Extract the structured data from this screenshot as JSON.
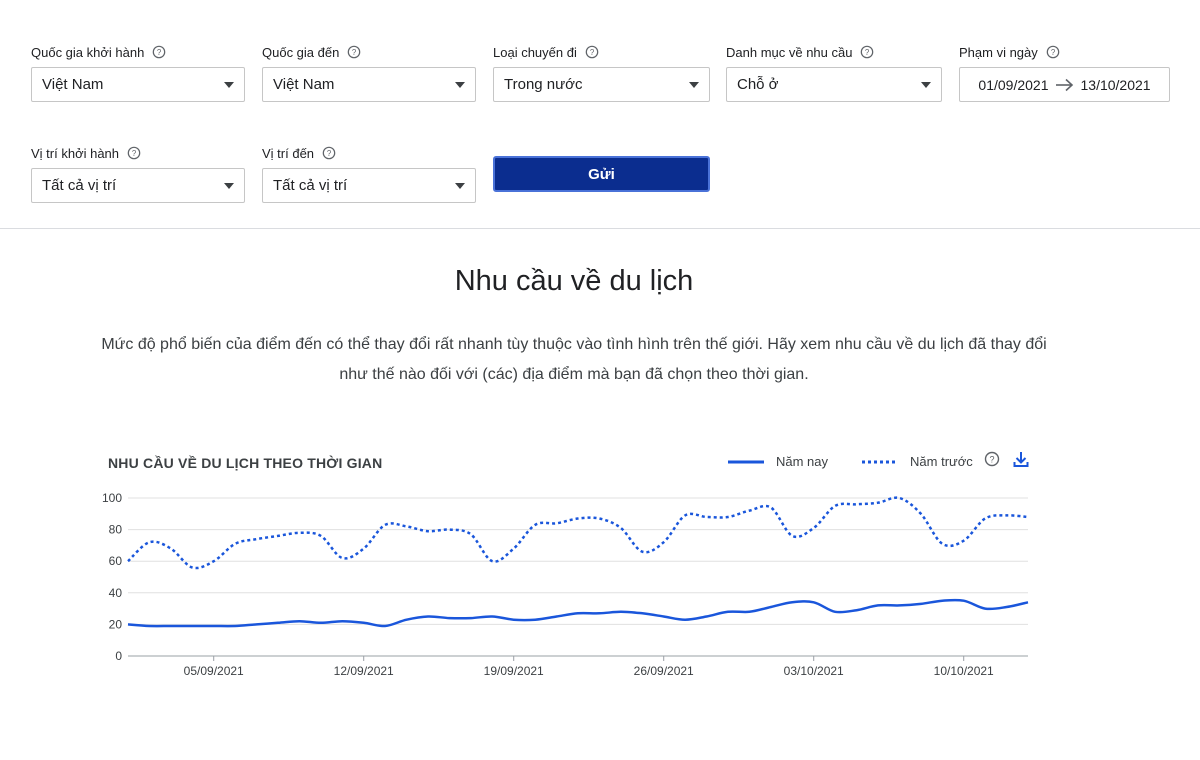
{
  "filters": {
    "origin_country": {
      "label": "Quốc gia khởi hành",
      "value": "Việt Nam"
    },
    "dest_country": {
      "label": "Quốc gia đến",
      "value": "Việt Nam"
    },
    "trip_type": {
      "label": "Loại chuyến đi",
      "value": "Trong nước"
    },
    "demand_category": {
      "label": "Danh mục về nhu cầu",
      "value": "Chỗ ở"
    },
    "date_range": {
      "label": "Phạm vi ngày",
      "start": "01/09/2021",
      "end": "13/10/2021"
    },
    "origin_location": {
      "label": "Vị trí khởi hành",
      "value": "Tất cả vị trí"
    },
    "dest_location": {
      "label": "Vị trí đến",
      "value": "Tất cả vị trí"
    },
    "submit_label": "Gửi"
  },
  "section": {
    "heading": "Nhu cầu về du lịch",
    "description": "Mức độ phổ biến của điểm đến có thể thay đổi rất nhanh tùy thuộc vào tình hình trên thế giới. Hãy xem nhu cầu về du lịch đã thay đổi như thế nào đối với (các) địa điểm mà bạn đã chọn theo thời gian."
  },
  "colors": {
    "series": "#1a56db",
    "submit_bg": "#0b2d8f",
    "grid": "#e0e0e0",
    "axis": "#9aa0a6"
  },
  "icons": {
    "help": "help-circle-icon",
    "download": "download-icon",
    "arrow": "arrow-right-icon",
    "caret": "chevron-down-icon"
  },
  "chart_data": {
    "type": "line",
    "title": "NHU CẦU VỀ DU LỊCH THEO THỜI GIAN",
    "xlabel": "",
    "ylabel": "",
    "ylim": [
      0,
      100
    ],
    "y_ticks": [
      0,
      20,
      40,
      60,
      80,
      100
    ],
    "x_start": "01/09/2021",
    "x_tick_labels": [
      "05/09/2021",
      "12/09/2021",
      "19/09/2021",
      "26/09/2021",
      "03/10/2021",
      "10/10/2021"
    ],
    "x_tick_day_index": [
      4,
      11,
      18,
      25,
      32,
      39
    ],
    "grid": true,
    "legend_position": "top-right",
    "series": [
      {
        "name": "Năm nay",
        "style": "solid",
        "values": [
          20,
          19,
          19,
          19,
          19,
          19,
          20,
          21,
          22,
          21,
          22,
          21,
          19,
          23,
          25,
          24,
          24,
          25,
          23,
          23,
          25,
          27,
          27,
          28,
          27,
          25,
          23,
          25,
          28,
          28,
          31,
          34,
          34,
          28,
          29,
          32,
          32,
          33,
          35,
          35,
          30,
          31,
          34
        ]
      },
      {
        "name": "Năm trước",
        "style": "dotted",
        "values": [
          60,
          72,
          68,
          56,
          60,
          71,
          74,
          76,
          78,
          76,
          62,
          68,
          83,
          82,
          79,
          80,
          77,
          60,
          68,
          83,
          84,
          87,
          87,
          81,
          66,
          72,
          89,
          88,
          88,
          92,
          94,
          76,
          81,
          95,
          96,
          97,
          100,
          90,
          71,
          73,
          87,
          89,
          88
        ]
      }
    ]
  }
}
